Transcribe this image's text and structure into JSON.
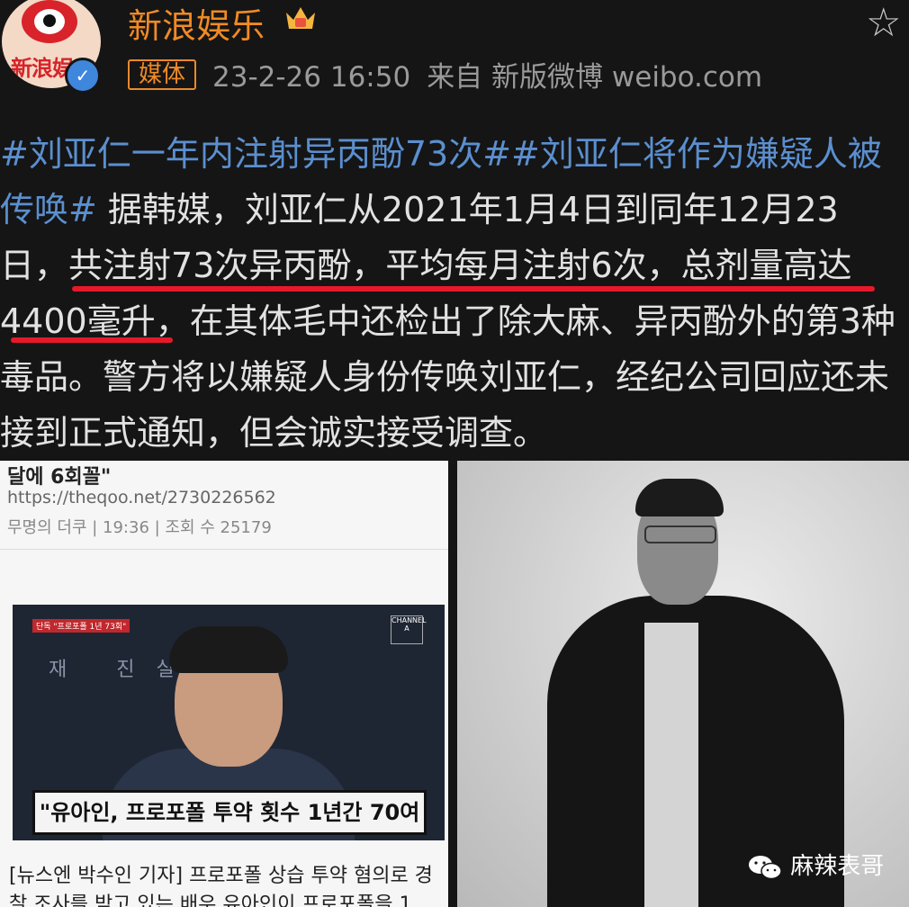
{
  "header": {
    "account_name": "新浪娱乐",
    "avatar_text": "新浪娱",
    "media_tag": "媒体",
    "date": "23-2-26 16:50",
    "source": "来自 新版微博 weibo.com"
  },
  "post": {
    "hashtag1": "#刘亚仁一年内注射异丙酚73次#",
    "hashtag2": "#刘亚仁将作为嫌疑人被传唤#",
    "body_part1": " 据韩媒，刘亚仁从2021年1月4日到同年12月23日，",
    "body_highlight": "共注射73次异丙酚，平均每月注射6次，总剂量高达4400毫升",
    "body_part2": "，在其体毛中还检出了除大麻、异丙酚外的第3种毒品。警方将以嫌疑人身份传唤刘亚仁，经纪公司回应还未接到正式通知，但会诚实接受调查。"
  },
  "left_image": {
    "headline_fragment": "달에 6회꼴\"",
    "url": "https://theqoo.net/2730226562",
    "info": "무명의 더쿠  |  19:36  |  조회 수 25179",
    "video_badge": "단독 \"프로포폴 1년 73회\"",
    "channel_mark": "CHANNEL A",
    "background_text": "재 진실을 봐",
    "caption": "\"유아인, 프로포폴 투약 횟수 1년간 70여 회\"",
    "body": "[뉴스엔 박수인 기자] 프로포폴 상습 투약 혐의로 경찰 조사를 받고 있는 배우 유아인이 프로포폴을 1"
  },
  "watermark": {
    "label": "麻辣表哥",
    "icon": "wechat-icon"
  },
  "colors": {
    "background": "#151515",
    "name": "#f08a24",
    "hashtag": "#5b8fcf",
    "underline": "#e6192b",
    "verified": "#3f86dd"
  }
}
